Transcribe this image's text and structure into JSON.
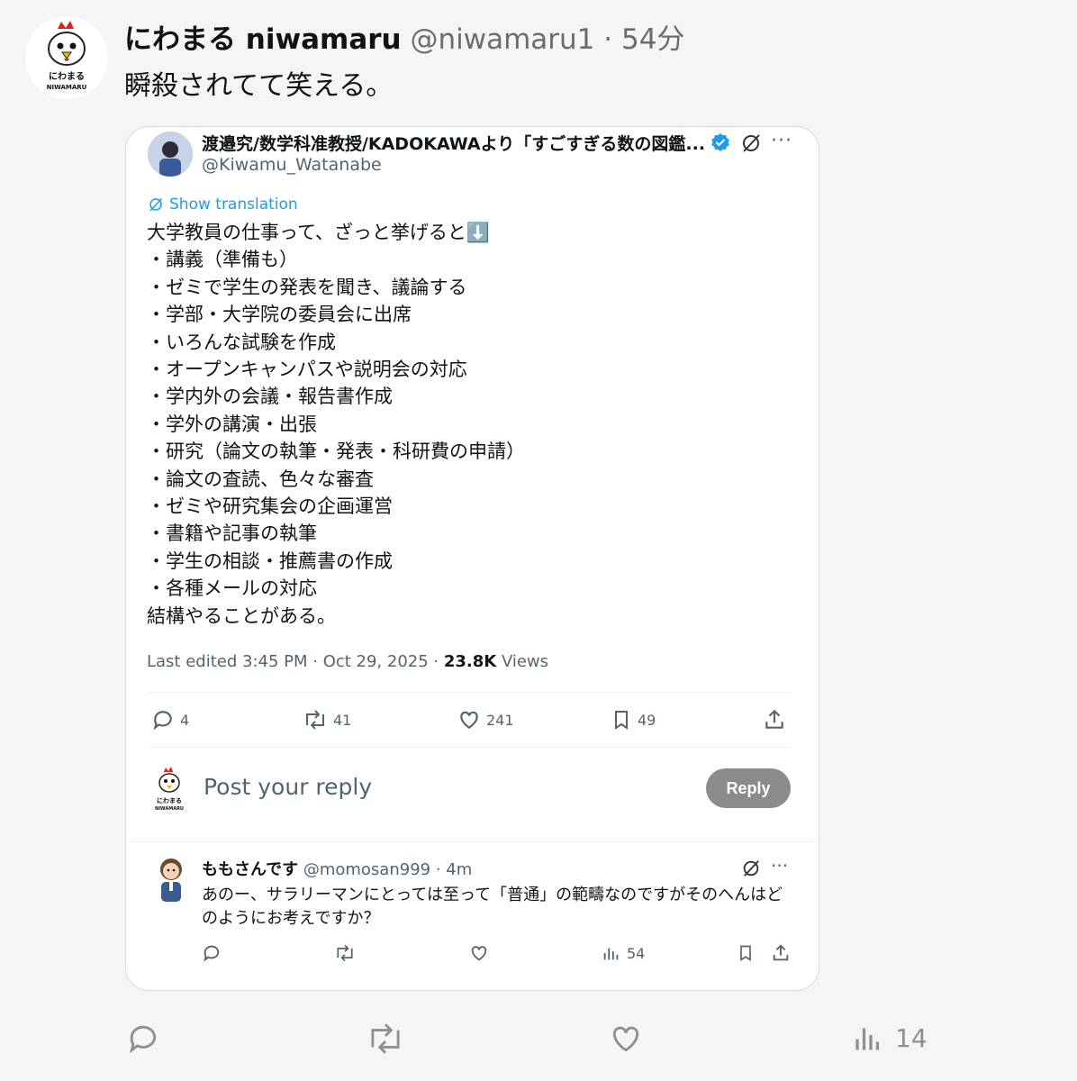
{
  "post": {
    "display_name": "にわまる niwamaru",
    "handle_time": "@niwamaru1 · 54分",
    "text": "瞬殺されてて笑える。",
    "avatar_caption_top": "にわまる",
    "avatar_caption_bottom": "NIWAMARU"
  },
  "quoted": {
    "display_name": "渡邉究/数学科准教授/KADOKAWAより「すごすぎる数の図鑑...",
    "handle": "@Kiwamu_Watanabe",
    "show_translation": "Show translation",
    "lines": [
      "大学教員の仕事って、ざっと挙げると⬇️",
      "・講義（準備も）",
      "・ゼミで学生の発表を聞き、議論する",
      "・学部・大学院の委員会に出席",
      "・いろんな試験を作成",
      "・オープンキャンパスや説明会の対応",
      "・学内外の会議・報告書作成",
      "・学外の講演・出張",
      "・研究（論文の執筆・発表・科研費の申請）",
      "・論文の査読、色々な審査",
      "・ゼミや研究集会の企画運営",
      "・書籍や記事の執筆",
      "・学生の相談・推薦書の作成",
      "・各種メールの対応",
      "結構やることがある。"
    ],
    "meta_prefix": "Last edited 3:45 PM · Oct 29, 2025 · ",
    "views_count": "23.8K",
    "views_label": " Views",
    "stats": {
      "replies": "4",
      "retweets": "41",
      "likes": "241",
      "bookmarks": "49"
    },
    "reply_placeholder": "Post your reply",
    "reply_button": "Reply",
    "reply_avatar_caption": "にわまる",
    "reply_avatar_caption2": "NIWAMARU",
    "reply": {
      "display_name": "ももさんです",
      "handle_time": " @momosan999 · 4m",
      "text": "あのー、サラリーマンにとっては至って「普通」の範疇なのですがそのへんはどのようにお考えですか？",
      "views": "54"
    }
  },
  "outer_stats": {
    "views": "14"
  },
  "colors": {
    "accent": "#1d9bf0",
    "muted": "#8e8e93",
    "reply_button": "#8b8b8b"
  }
}
